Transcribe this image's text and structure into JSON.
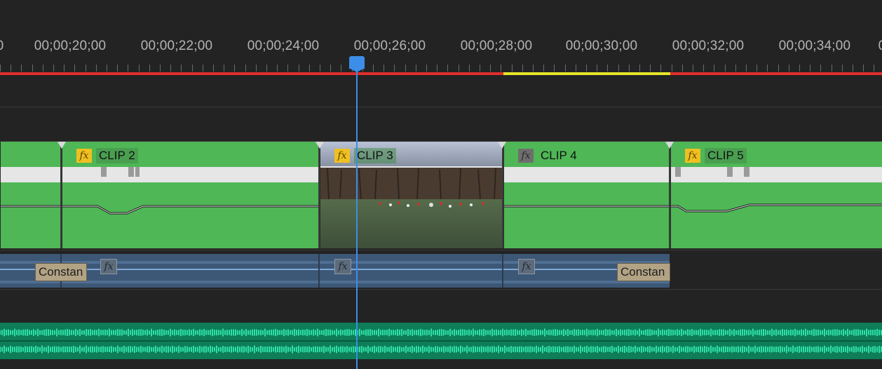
{
  "timeline": {
    "ruler_labels": [
      "0",
      "00;00;20;00",
      "00;00;22;00",
      "00;00;24;00",
      "00;00;26;00",
      "00;00;28;00",
      "00;00;30;00",
      "00;00;32;00",
      "00;00;34;00",
      "0"
    ],
    "playhead_timecode": "00;00;26;00",
    "render_bar_colors": {
      "unrendered": "#e02e2e",
      "needs_render": "#e6e62a"
    }
  },
  "video_track": {
    "clip_color": "#4fb756",
    "clips": [
      {
        "name": "",
        "fx_active": false
      },
      {
        "name": "CLIP 2",
        "fx_active": true
      },
      {
        "name": "CLIP 3",
        "fx_active": true,
        "has_thumbnail": true
      },
      {
        "name": "CLIP 4",
        "fx_active": false
      },
      {
        "name": "CLIP 5",
        "fx_active": true
      }
    ]
  },
  "audio_track_1": {
    "clip_color": "#3d5876",
    "transitions": [
      "Constan",
      "Constan"
    ],
    "fx_label": "fx"
  },
  "audio_track_2": {
    "clip_color": "#0e7d58"
  },
  "icons": {
    "fx": "fx",
    "playhead": "playhead-marker-icon"
  }
}
